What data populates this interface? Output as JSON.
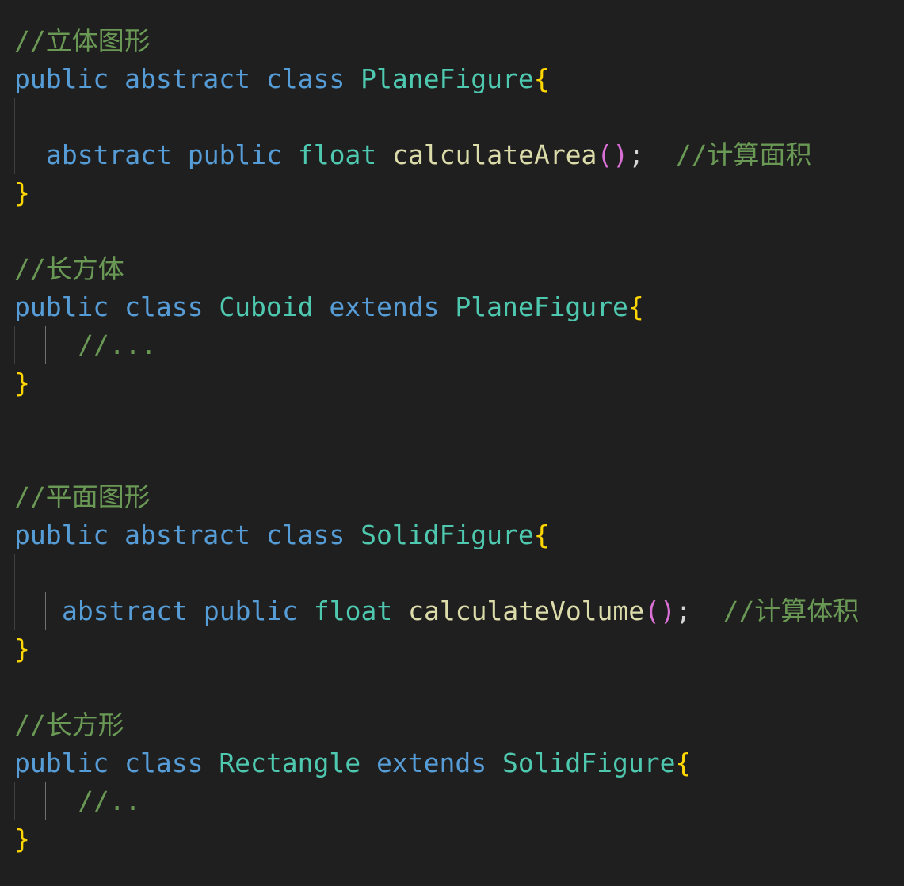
{
  "theme": {
    "background": "#1f1f1f",
    "keyword": "#569cd6",
    "type": "#4ec9b0",
    "function": "#dcdcaa",
    "comment": "#6a9955",
    "brace": "#ffd700",
    "paren": "#da70d6",
    "text": "#d4d4d4"
  },
  "code": {
    "block1": {
      "comment": "//立体图形",
      "kw_public": "public",
      "kw_abstract": "abstract",
      "kw_class": "class",
      "class_name": "PlaneFigure",
      "open_brace": "{",
      "method_abstract": "abstract",
      "method_public": "public",
      "method_type": "float",
      "method_name": "calculateArea",
      "parens": "()",
      "semicolon": ";",
      "method_comment": "//计算面积",
      "close_brace": "}"
    },
    "block2": {
      "comment": "//长方体",
      "kw_public": "public",
      "kw_class": "class",
      "class_name": "Cuboid",
      "kw_extends": "extends",
      "parent_name": "PlaneFigure",
      "open_brace": "{",
      "body_comment": "//...",
      "close_brace": "}"
    },
    "block3": {
      "comment": "//平面图形",
      "kw_public": "public",
      "kw_abstract": "abstract",
      "kw_class": "class",
      "class_name": "SolidFigure",
      "open_brace": "{",
      "method_abstract": "abstract",
      "method_public": "public",
      "method_type": "float",
      "method_name": "calculateVolume",
      "parens": "()",
      "semicolon": ";",
      "method_comment": "//计算体积",
      "close_brace": "}"
    },
    "block4": {
      "comment": "//长方形",
      "kw_public": "public",
      "kw_class": "class",
      "class_name": "Rectangle",
      "kw_extends": "extends",
      "parent_name": "SolidFigure",
      "open_brace": "{",
      "body_comment": "//..",
      "close_brace": "}"
    }
  }
}
